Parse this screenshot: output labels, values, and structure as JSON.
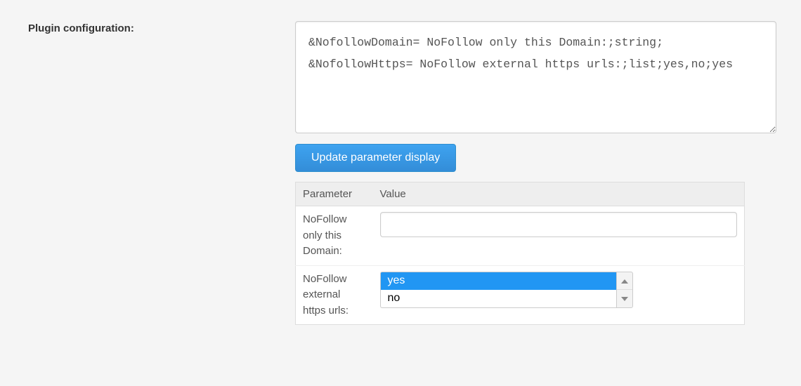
{
  "label": "Plugin configuration:",
  "configText": "&NofollowDomain= NoFollow only this Domain:;string; &NofollowHttps= NoFollow external https urls:;list;yes,no;yes",
  "updateButton": "Update parameter display",
  "tableHeaders": {
    "parameter": "Parameter",
    "value": "Value"
  },
  "rows": [
    {
      "name": "NoFollow only this Domain:",
      "type": "string",
      "value": ""
    },
    {
      "name": "NoFollow external https urls:",
      "type": "list",
      "options": [
        "yes",
        "no"
      ],
      "selected": "yes"
    }
  ]
}
